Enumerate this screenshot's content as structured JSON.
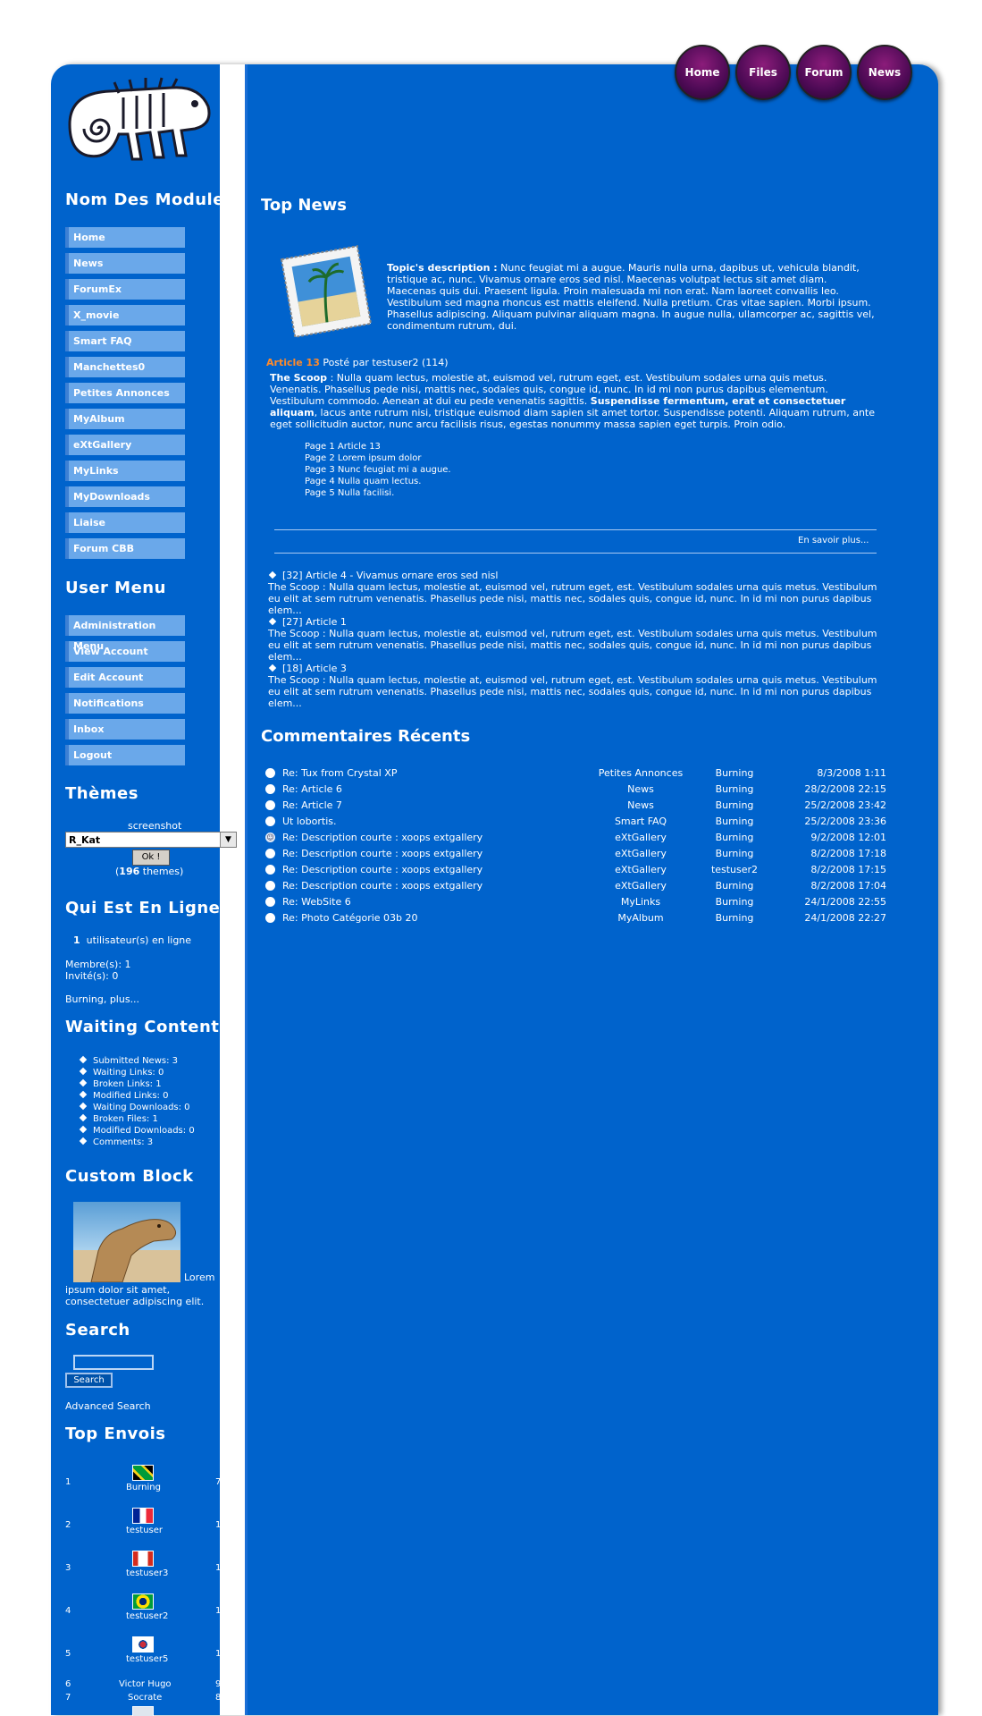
{
  "topnav": [
    "Home",
    "Files",
    "Forum",
    "News"
  ],
  "sidebar": {
    "modules_title": "Nom Des Modules",
    "modules": [
      "Home",
      "News",
      "ForumEx",
      "X_movie",
      "Smart FAQ",
      "Manchettes0",
      "Petites Annonces",
      "MyAlbum",
      "eXtGallery",
      "MyLinks",
      "MyDownloads",
      "Liaise",
      "Forum CBB"
    ],
    "usermenu_title": "User Menu",
    "usermenu": [
      "Administration Menu",
      "View Account",
      "Edit Account",
      "Notifications",
      "Inbox",
      "Logout"
    ],
    "themes_title": "Thèmes",
    "themes_screenshot": "screenshot",
    "theme_selected": "R_Kat",
    "themes_ok": "Ok !",
    "themes_count_prefix": "(",
    "themes_count": "196",
    "themes_count_suffix": " themes)",
    "online_title": "Qui Est En Ligne",
    "online_count": "1",
    "online_text": "utilisateur(s) en ligne",
    "online_members": "Membre(s): 1",
    "online_guests": "Invité(s): 0",
    "online_names": "Burning, plus...",
    "waiting_title": "Waiting Contents",
    "waiting": [
      "Submitted News: 3",
      "Waiting Links: 0",
      "Broken Links: 1",
      "Modified Links: 0",
      "Waiting Downloads: 0",
      "Broken Files: 1",
      "Modified Downloads: 0",
      "Comments: 3"
    ],
    "custom_title": "Custom Block",
    "custom_text_1": "Lorem",
    "custom_text_2": "ipsum dolor sit amet,",
    "custom_text_3": "consectetuer adipiscing elit.",
    "search_title": "Search",
    "search_button": "Search",
    "advanced_search": "Advanced Search",
    "top_title": "Top Envois",
    "top_envois": [
      {
        "rank": "1",
        "name": "Burning",
        "count": "7"
      },
      {
        "rank": "2",
        "name": "testuser",
        "count": "1"
      },
      {
        "rank": "3",
        "name": "testuser3",
        "count": "1"
      },
      {
        "rank": "4",
        "name": "testuser2",
        "count": "1"
      },
      {
        "rank": "5",
        "name": "testuser5",
        "count": "1"
      },
      {
        "rank": "6",
        "name": "Victor Hugo",
        "count": "9"
      },
      {
        "rank": "7",
        "name": "Socrate",
        "count": "8"
      }
    ]
  },
  "main": {
    "top_news_title": "Top News",
    "topic_label": "Topic's description :",
    "topic_text": "Nunc feugiat mi a augue. Mauris nulla urna, dapibus ut, vehicula blandit, tristique ac, nunc. Vivamus ornare eros sed nisl. Maecenas volutpat lectus sit amet diam. Maecenas quis dui. Praesent ligula. Proin malesuada mi non erat. Nam laoreet convallis leo. Vestibulum sed magna rhoncus est mattis eleifend. Nulla pretium. Cras vitae sapien. Morbi ipsum. Phasellus adipiscing. Aliquam pulvinar aliquam magna. In augue nulla, ullamcorper ac, sagittis vel, condimentum rutrum, dui.",
    "article_title": "Article 13",
    "article_meta": "Posté par testuser2 (114)",
    "scoop_label": "The Scoop",
    "scoop_text_1": ": Nulla quam lectus, molestie at, euismod vel, rutrum eget, est. Vestibulum sodales urna quis metus. Venenatis. Phasellus pede nisi, mattis nec, sodales quis, congue id, nunc. In id mi non purus dapibus elementum. Vestibulum commodo. Aenean at dui eu pede venenatis sagittis.",
    "scoop_bold": "Suspendisse fermentum, erat et consectetuer aliquam",
    "scoop_text_2": ", lacus ante rutrum nisi, tristique euismod diam sapien sit amet tortor. Suspendisse potenti. Aliquam rutrum, ante eget sollicitudin auctor, nunc arcu facilisis risus, egestas nonummy massa sapien eget turpis. Proin odio.",
    "pages": [
      "Page 1 Article 13",
      "Page 2 Lorem ipsum dolor",
      "Page 3 Nunc feugiat mi a augue.",
      "Page 4 Nulla quam lectus.",
      "Page 5 Nulla facilisi."
    ],
    "read_more": "En savoir plus...",
    "other_news": [
      {
        "title": "[32] Article 4 - Vivamus ornare eros sed nisl",
        "text": "The Scoop : Nulla quam lectus, molestie at, euismod vel, rutrum eget, est. Vestibulum sodales urna quis metus. Vestibulum eu elit at sem rutrum venenatis. Phasellus pede nisi, mattis nec, sodales quis, congue id, nunc. In id mi non purus dapibus elem..."
      },
      {
        "title": "[27] Article 1",
        "text": "The Scoop : Nulla quam lectus, molestie at, euismod vel, rutrum eget, est. Vestibulum sodales urna quis metus. Vestibulum eu elit at sem rutrum venenatis. Phasellus pede nisi, mattis nec, sodales quis, congue id, nunc. In id mi non purus dapibus elem..."
      },
      {
        "title": "[18] Article 3",
        "text": "The Scoop : Nulla quam lectus, molestie at, euismod vel, rutrum eget, est. Vestibulum sodales urna quis metus. Vestibulum eu elit at sem rutrum venenatis. Phasellus pede nisi, mattis nec, sodales quis, congue id, nunc. In id mi non purus dapibus elem..."
      }
    ],
    "comments_title": "Commentaires Récents",
    "comments": [
      {
        "title": "Re: Tux from Crystal XP",
        "module": "Petites Annonces",
        "user": "Burning",
        "date": "8/3/2008 1:11"
      },
      {
        "title": "Re: Article 6",
        "module": "News",
        "user": "Burning",
        "date": "28/2/2008 22:15"
      },
      {
        "title": "Re: Article 7",
        "module": "News",
        "user": "Burning",
        "date": "25/2/2008 23:42"
      },
      {
        "title": "Ut lobortis.",
        "module": "Smart FAQ",
        "user": "Burning",
        "date": "25/2/2008 23:36"
      },
      {
        "title": "Re: Description courte : xoops extgallery",
        "module": "eXtGallery",
        "user": "Burning",
        "date": "9/2/2008 12:01"
      },
      {
        "title": "Re: Description courte : xoops extgallery",
        "module": "eXtGallery",
        "user": "Burning",
        "date": "8/2/2008 17:18"
      },
      {
        "title": "Re: Description courte : xoops extgallery",
        "module": "eXtGallery",
        "user": "testuser2",
        "date": "8/2/2008 17:15"
      },
      {
        "title": "Re: Description courte : xoops extgallery",
        "module": "eXtGallery",
        "user": "Burning",
        "date": "8/2/2008 17:04"
      },
      {
        "title": "Re: WebSite 6",
        "module": "MyLinks",
        "user": "Burning",
        "date": "24/1/2008 22:55"
      },
      {
        "title": "Re: Photo Catégorie 03b 20",
        "module": "MyAlbum",
        "user": "Burning",
        "date": "24/1/2008 22:27"
      }
    ]
  }
}
